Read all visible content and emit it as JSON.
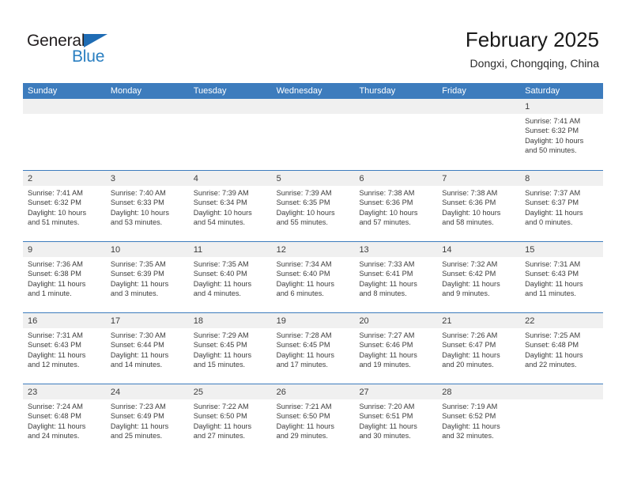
{
  "brand": {
    "name_part1": "General",
    "name_part2": "Blue"
  },
  "header": {
    "title": "February 2025",
    "subtitle": "Dongxi, Chongqing, China"
  },
  "colors": {
    "header_bar": "#3d7cbd",
    "brand_blue": "#2a7fc1",
    "day_band": "#f0f0f0",
    "text": "#3c3c3c"
  },
  "day_names": [
    "Sunday",
    "Monday",
    "Tuesday",
    "Wednesday",
    "Thursday",
    "Friday",
    "Saturday"
  ],
  "weeks": [
    [
      {
        "day": "",
        "empty": true,
        "sunrise": "",
        "sunset": "",
        "daylight1": "",
        "daylight2": ""
      },
      {
        "day": "",
        "empty": true,
        "sunrise": "",
        "sunset": "",
        "daylight1": "",
        "daylight2": ""
      },
      {
        "day": "",
        "empty": true,
        "sunrise": "",
        "sunset": "",
        "daylight1": "",
        "daylight2": ""
      },
      {
        "day": "",
        "empty": true,
        "sunrise": "",
        "sunset": "",
        "daylight1": "",
        "daylight2": ""
      },
      {
        "day": "",
        "empty": true,
        "sunrise": "",
        "sunset": "",
        "daylight1": "",
        "daylight2": ""
      },
      {
        "day": "",
        "empty": true,
        "sunrise": "",
        "sunset": "",
        "daylight1": "",
        "daylight2": ""
      },
      {
        "day": "1",
        "empty": false,
        "sunrise": "Sunrise: 7:41 AM",
        "sunset": "Sunset: 6:32 PM",
        "daylight1": "Daylight: 10 hours",
        "daylight2": "and 50 minutes."
      }
    ],
    [
      {
        "day": "2",
        "empty": false,
        "sunrise": "Sunrise: 7:41 AM",
        "sunset": "Sunset: 6:32 PM",
        "daylight1": "Daylight: 10 hours",
        "daylight2": "and 51 minutes."
      },
      {
        "day": "3",
        "empty": false,
        "sunrise": "Sunrise: 7:40 AM",
        "sunset": "Sunset: 6:33 PM",
        "daylight1": "Daylight: 10 hours",
        "daylight2": "and 53 minutes."
      },
      {
        "day": "4",
        "empty": false,
        "sunrise": "Sunrise: 7:39 AM",
        "sunset": "Sunset: 6:34 PM",
        "daylight1": "Daylight: 10 hours",
        "daylight2": "and 54 minutes."
      },
      {
        "day": "5",
        "empty": false,
        "sunrise": "Sunrise: 7:39 AM",
        "sunset": "Sunset: 6:35 PM",
        "daylight1": "Daylight: 10 hours",
        "daylight2": "and 55 minutes."
      },
      {
        "day": "6",
        "empty": false,
        "sunrise": "Sunrise: 7:38 AM",
        "sunset": "Sunset: 6:36 PM",
        "daylight1": "Daylight: 10 hours",
        "daylight2": "and 57 minutes."
      },
      {
        "day": "7",
        "empty": false,
        "sunrise": "Sunrise: 7:38 AM",
        "sunset": "Sunset: 6:36 PM",
        "daylight1": "Daylight: 10 hours",
        "daylight2": "and 58 minutes."
      },
      {
        "day": "8",
        "empty": false,
        "sunrise": "Sunrise: 7:37 AM",
        "sunset": "Sunset: 6:37 PM",
        "daylight1": "Daylight: 11 hours",
        "daylight2": "and 0 minutes."
      }
    ],
    [
      {
        "day": "9",
        "empty": false,
        "sunrise": "Sunrise: 7:36 AM",
        "sunset": "Sunset: 6:38 PM",
        "daylight1": "Daylight: 11 hours",
        "daylight2": "and 1 minute."
      },
      {
        "day": "10",
        "empty": false,
        "sunrise": "Sunrise: 7:35 AM",
        "sunset": "Sunset: 6:39 PM",
        "daylight1": "Daylight: 11 hours",
        "daylight2": "and 3 minutes."
      },
      {
        "day": "11",
        "empty": false,
        "sunrise": "Sunrise: 7:35 AM",
        "sunset": "Sunset: 6:40 PM",
        "daylight1": "Daylight: 11 hours",
        "daylight2": "and 4 minutes."
      },
      {
        "day": "12",
        "empty": false,
        "sunrise": "Sunrise: 7:34 AM",
        "sunset": "Sunset: 6:40 PM",
        "daylight1": "Daylight: 11 hours",
        "daylight2": "and 6 minutes."
      },
      {
        "day": "13",
        "empty": false,
        "sunrise": "Sunrise: 7:33 AM",
        "sunset": "Sunset: 6:41 PM",
        "daylight1": "Daylight: 11 hours",
        "daylight2": "and 8 minutes."
      },
      {
        "day": "14",
        "empty": false,
        "sunrise": "Sunrise: 7:32 AM",
        "sunset": "Sunset: 6:42 PM",
        "daylight1": "Daylight: 11 hours",
        "daylight2": "and 9 minutes."
      },
      {
        "day": "15",
        "empty": false,
        "sunrise": "Sunrise: 7:31 AM",
        "sunset": "Sunset: 6:43 PM",
        "daylight1": "Daylight: 11 hours",
        "daylight2": "and 11 minutes."
      }
    ],
    [
      {
        "day": "16",
        "empty": false,
        "sunrise": "Sunrise: 7:31 AM",
        "sunset": "Sunset: 6:43 PM",
        "daylight1": "Daylight: 11 hours",
        "daylight2": "and 12 minutes."
      },
      {
        "day": "17",
        "empty": false,
        "sunrise": "Sunrise: 7:30 AM",
        "sunset": "Sunset: 6:44 PM",
        "daylight1": "Daylight: 11 hours",
        "daylight2": "and 14 minutes."
      },
      {
        "day": "18",
        "empty": false,
        "sunrise": "Sunrise: 7:29 AM",
        "sunset": "Sunset: 6:45 PM",
        "daylight1": "Daylight: 11 hours",
        "daylight2": "and 15 minutes."
      },
      {
        "day": "19",
        "empty": false,
        "sunrise": "Sunrise: 7:28 AM",
        "sunset": "Sunset: 6:45 PM",
        "daylight1": "Daylight: 11 hours",
        "daylight2": "and 17 minutes."
      },
      {
        "day": "20",
        "empty": false,
        "sunrise": "Sunrise: 7:27 AM",
        "sunset": "Sunset: 6:46 PM",
        "daylight1": "Daylight: 11 hours",
        "daylight2": "and 19 minutes."
      },
      {
        "day": "21",
        "empty": false,
        "sunrise": "Sunrise: 7:26 AM",
        "sunset": "Sunset: 6:47 PM",
        "daylight1": "Daylight: 11 hours",
        "daylight2": "and 20 minutes."
      },
      {
        "day": "22",
        "empty": false,
        "sunrise": "Sunrise: 7:25 AM",
        "sunset": "Sunset: 6:48 PM",
        "daylight1": "Daylight: 11 hours",
        "daylight2": "and 22 minutes."
      }
    ],
    [
      {
        "day": "23",
        "empty": false,
        "sunrise": "Sunrise: 7:24 AM",
        "sunset": "Sunset: 6:48 PM",
        "daylight1": "Daylight: 11 hours",
        "daylight2": "and 24 minutes."
      },
      {
        "day": "24",
        "empty": false,
        "sunrise": "Sunrise: 7:23 AM",
        "sunset": "Sunset: 6:49 PM",
        "daylight1": "Daylight: 11 hours",
        "daylight2": "and 25 minutes."
      },
      {
        "day": "25",
        "empty": false,
        "sunrise": "Sunrise: 7:22 AM",
        "sunset": "Sunset: 6:50 PM",
        "daylight1": "Daylight: 11 hours",
        "daylight2": "and 27 minutes."
      },
      {
        "day": "26",
        "empty": false,
        "sunrise": "Sunrise: 7:21 AM",
        "sunset": "Sunset: 6:50 PM",
        "daylight1": "Daylight: 11 hours",
        "daylight2": "and 29 minutes."
      },
      {
        "day": "27",
        "empty": false,
        "sunrise": "Sunrise: 7:20 AM",
        "sunset": "Sunset: 6:51 PM",
        "daylight1": "Daylight: 11 hours",
        "daylight2": "and 30 minutes."
      },
      {
        "day": "28",
        "empty": false,
        "sunrise": "Sunrise: 7:19 AM",
        "sunset": "Sunset: 6:52 PM",
        "daylight1": "Daylight: 11 hours",
        "daylight2": "and 32 minutes."
      },
      {
        "day": "",
        "empty": true,
        "sunrise": "",
        "sunset": "",
        "daylight1": "",
        "daylight2": ""
      }
    ]
  ]
}
